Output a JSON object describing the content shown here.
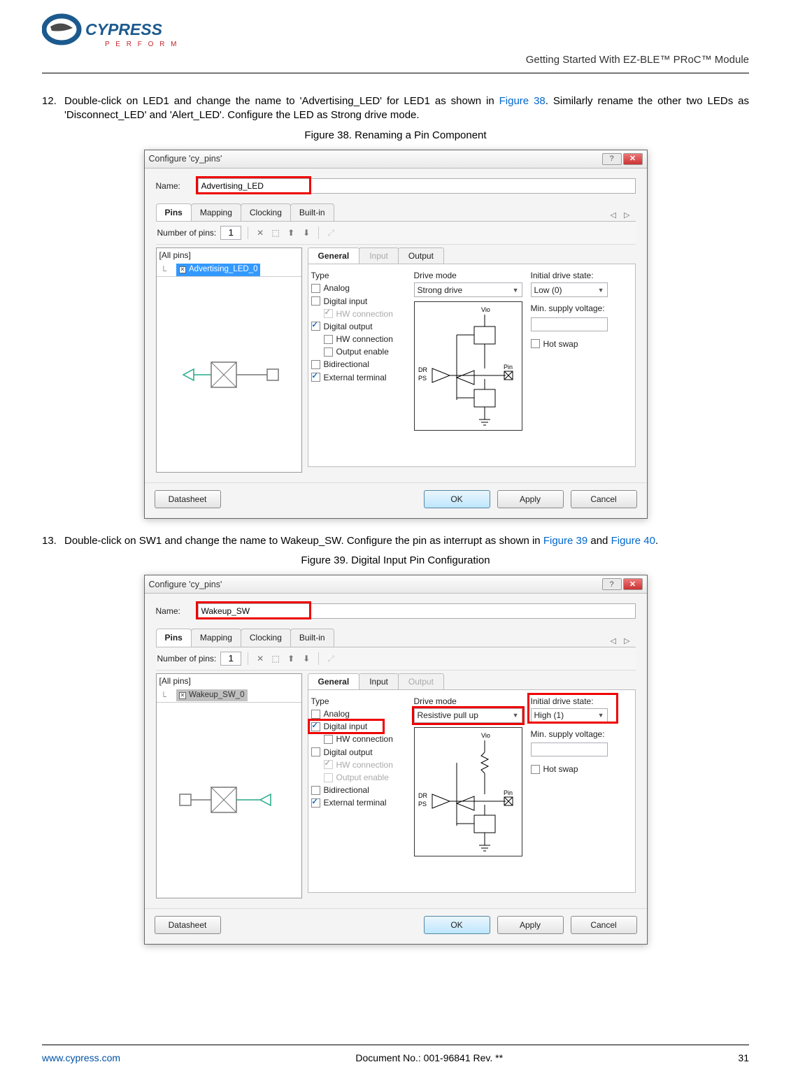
{
  "header": {
    "brand_top": "CYPRESS",
    "brand_sub": "P E R F O R M",
    "doc_title": "Getting Started With EZ-BLE™ PRoC™ Module"
  },
  "step12": {
    "num": "12.",
    "text_a": "Double-click on LED1 and change the name to 'Advertising_LED' for LED1 as shown in ",
    "fig_link": "Figure 38",
    "text_b": ". Similarly rename the other two LEDs as 'Disconnect_LED' and 'Alert_LED'. Configure the LED as Strong drive mode."
  },
  "fig38_caption": "Figure 38. Renaming a Pin Component",
  "step13": {
    "num": "13.",
    "text_a": "Double-click on SW1 and change the name to Wakeup_SW. Configure the pin as interrupt as shown in ",
    "fig_link1": "Figure 39",
    "mid": " and ",
    "fig_link2": "Figure 40",
    "end": "."
  },
  "fig39_caption": "Figure 39. Digital Input Pin Configuration",
  "dialog": {
    "title": "Configure 'cy_pins'",
    "name_label": "Name:",
    "tabs": {
      "pins": "Pins",
      "mapping": "Mapping",
      "clocking": "Clocking",
      "builtin": "Built-in"
    },
    "numpins_label": "Number of pins:",
    "numpins_value": "1",
    "allpins": "[All pins]",
    "inner_tabs": {
      "general": "General",
      "input": "Input",
      "output": "Output"
    },
    "type_label": "Type",
    "types": {
      "analog": "Analog",
      "digital_input": "Digital input",
      "hw_conn": "HW connection",
      "digital_output": "Digital output",
      "hw_conn2": "HW connection",
      "output_enable": "Output enable",
      "bidirectional": "Bidirectional",
      "ext_terminal": "External terminal"
    },
    "drive_label": "Drive mode",
    "circuit_labels": {
      "vio": "Vio",
      "dr": "DR",
      "ps": "PS",
      "pin": "Pin"
    },
    "state_label": "Initial drive state:",
    "minv_label": "Min. supply voltage:",
    "hotswap": "Hot swap",
    "buttons": {
      "datasheet": "Datasheet",
      "ok": "OK",
      "apply": "Apply",
      "cancel": "Cancel"
    }
  },
  "fig38": {
    "name_value": "Advertising_LED",
    "tree_item": "Advertising_LED_0",
    "drive_value": "Strong drive",
    "state_value": "Low (0)",
    "input_tab_enabled": false,
    "digital_input_checked": false,
    "digital_output_checked": true
  },
  "fig39": {
    "name_value": "Wakeup_SW",
    "tree_item": "Wakeup_SW_0",
    "drive_value": "Resistive pull up",
    "state_value": "High (1)",
    "input_tab_enabled": true,
    "digital_input_checked": true,
    "digital_output_checked": false
  },
  "footer": {
    "url": "www.cypress.com",
    "doc_no": "Document No.: 001-96841 Rev. **",
    "page": "31"
  }
}
